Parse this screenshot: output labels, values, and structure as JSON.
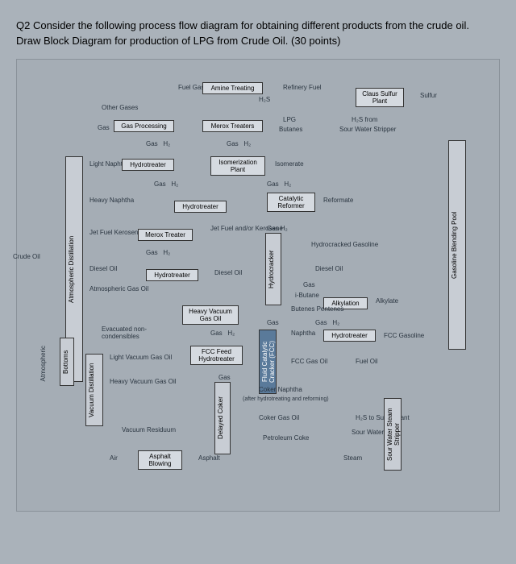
{
  "question": {
    "line1": "Q2 Consider the following process flow diagram for obtaining different products from the crude oil.",
    "line2": "Draw Block Diagram for production of LPG from Crude Oil. (30 points)"
  },
  "labels": {
    "crude_oil": "Crude Oil",
    "other_gases": "Other Gases",
    "fuel_gas": "Fuel Gas",
    "amine_treating": "Amine Treating",
    "refinery_fuel": "Refinery Fuel",
    "h2s": "H₂S",
    "claus_sulfur": "Claus Sulfur Plant",
    "sulfur": "Sulfur",
    "gas_processing": "Gas Processing",
    "merox_treaters": "Merox Treaters",
    "lpg": "LPG",
    "butanes": "Butanes",
    "h2s_from": "H₂S from",
    "sour_water": "Sour Water Stripper",
    "gas": "Gas",
    "h2": "H₂",
    "light_naphtha": "Light Naphtha",
    "hydrotreater": "Hydrotreater",
    "isomerization": "Isomerization Plant",
    "isomerate": "Isomerate",
    "heavy_naphtha": "Heavy Naphtha",
    "catalytic_reformer": "Catalytic Reformer",
    "reformate": "Reformate",
    "jet_fuel_kerosene": "Jet Fuel Kerosene",
    "merox_treater": "Merox Treater",
    "jet_fuel_andor": "Jet Fuel and/or Kerosene",
    "hydrocracker": "Hydrocracker",
    "hydrocracked_gasoline": "Hydrocracked Gasoline",
    "diesel_oil": "Diesel Oil",
    "atmospheric_gasoil": "Atmospheric Gas Oil",
    "ibutane": "i-Butane",
    "alkylation": "Alkylation",
    "alkylate": "Alkylate",
    "butenes_pentenes": "Butenes Pentenes",
    "heavy_vacuum": "Heavy Vacuum Gas Oil",
    "evacuated": "Evacuated non-condensibles",
    "naphtha": "Naphtha",
    "fcc_gasoline": "FCC Gasoline",
    "light_vacuum": "Light Vacuum Gas Oil",
    "fcc_feed": "FCC Feed Hydrotreater",
    "fcc": "Fluid Catalytic Cracker (FCC)",
    "fcc_gas_oil": "FCC Gas Oil",
    "fuel_oil": "Fuel Oil",
    "heavy_vacuum_gasoil": "Heavy Vacuum Gas Oil",
    "coker_naphtha": "Coker Naphtha",
    "after_hydro": "(after hydrotreating and reforming)",
    "vacuum_residuum": "Vacuum Residuum",
    "delayed_coker": "Delayed Coker",
    "coker_gas_oil": "Coker Gas Oil",
    "h2s_to_sulfur": "H₂S to Sulfur Plant",
    "petroleum_coke": "Petroleum Coke",
    "sour_waters": "Sour Waters",
    "steam": "Steam",
    "air": "Air",
    "asphalt_blowing": "Asphalt Blowing",
    "asphalt": "Asphalt",
    "atmospheric_dist": "Atmospheric Distillation",
    "vacuum_dist": "Vacuum Distillation",
    "bottoms": "Bottoms",
    "gasoline_blending": "Gasoline Blending Pool",
    "sour_water_stripper": "Sour Water Steam Stripper"
  }
}
